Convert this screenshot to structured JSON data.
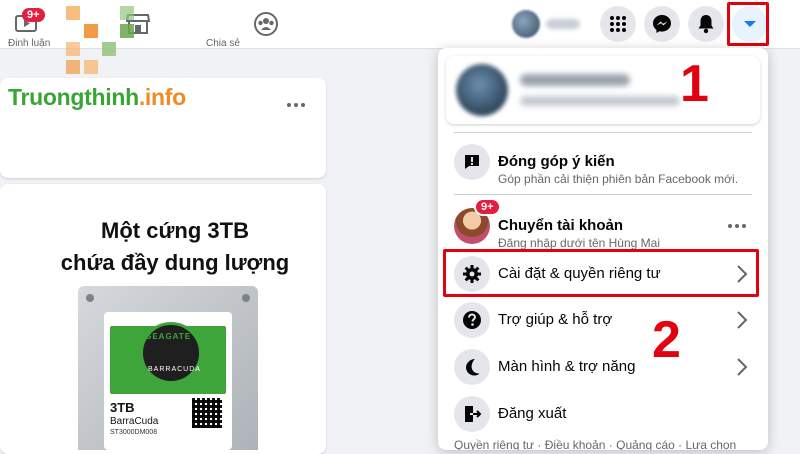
{
  "topbar": {
    "watch_badge": "9+",
    "watch_label": "Đinh luận",
    "groups_label": "Chia sẻ",
    "active_color": "#1877f2"
  },
  "watermark": {
    "brand_green": "Truongthinh",
    "brand_orange": ".info"
  },
  "ad": {
    "line1": "Một cứng 3TB",
    "line2": "chứa đầy dung lượng",
    "drive_brand": "SEAGATE",
    "drive_series": "BARRACUDA",
    "drive_capacity": "3TB",
    "drive_model": "BarraCuda",
    "drive_serial": "ST3000DM008"
  },
  "menu": {
    "items": [
      {
        "title": "Đóng góp ý kiến",
        "subtitle": "Góp phần cải thiện phiên bản Facebook mới.",
        "icon": "feedback-icon"
      },
      {
        "title": "Chuyển tài khoản",
        "subtitle": "Đăng nhập dưới tên Hùng Mai",
        "icon": "avatar",
        "badge": "9+"
      },
      {
        "title": "Cài đặt & quyền riêng tư",
        "icon": "gear-icon"
      },
      {
        "title": "Trợ giúp & hỗ trợ",
        "icon": "help-icon"
      },
      {
        "title": "Màn hình & trợ năng",
        "icon": "moon-icon"
      },
      {
        "title": "Đăng xuất",
        "icon": "logout-icon"
      }
    ],
    "footer": "Quyền riêng tư · Điều khoản · Quảng cáo · Lựa chọn"
  },
  "annotations": {
    "step1": "1",
    "step2": "2",
    "highlight_color": "#e3000f"
  }
}
